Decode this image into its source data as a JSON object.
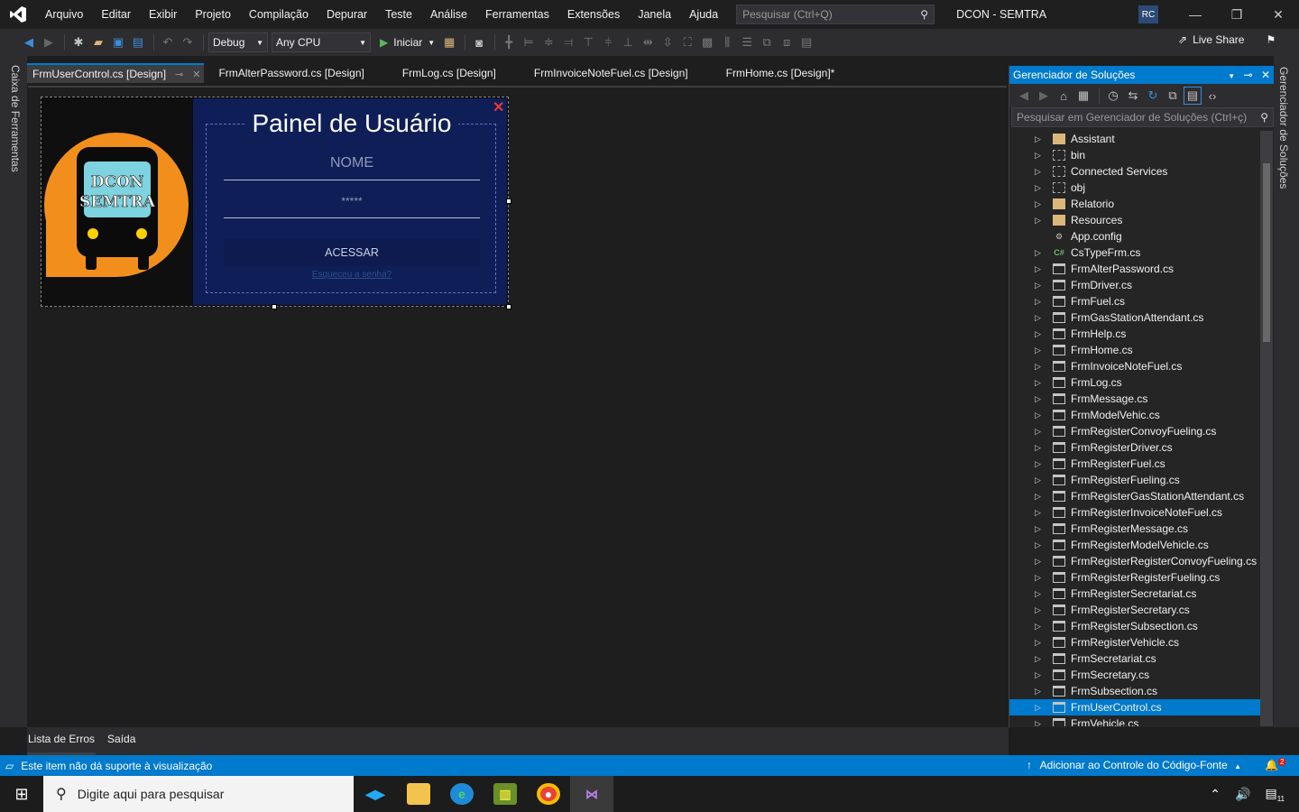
{
  "menu": {
    "items": [
      "Arquivo",
      "Editar",
      "Exibir",
      "Projeto",
      "Compilação",
      "Depurar",
      "Teste",
      "Análise",
      "Ferramentas",
      "Extensões",
      "Janela",
      "Ajuda"
    ],
    "search_placeholder": "Pesquisar (Ctrl+Q)",
    "window_title": "DCON - SEMTRA",
    "user_initials": "RC"
  },
  "toolbar": {
    "config": "Debug",
    "platform": "Any CPU",
    "start_label": "Iniciar",
    "liveshare_label": "Live Share"
  },
  "toolbox": {
    "label": "Caixa de Ferramentas"
  },
  "doc_tabs": [
    "FrmUserControl.cs [Design]",
    "FrmAlterPassword.cs [Design]",
    "FrmLog.cs [Design]",
    "FrmInvoiceNoteFuel.cs [Design]",
    "FrmHome.cs [Design]*"
  ],
  "form": {
    "title": "Painel de Usuário",
    "logo_line1": "DCON",
    "logo_line2": "SEMTRA",
    "name_placeholder": "NOME",
    "password_value": "*****",
    "button_label": "ACESSAR",
    "forgot_link": "Esqueceu a senha?",
    "close_glyph": "✕"
  },
  "bottom_tabs": [
    "Lista de Erros",
    "Saída"
  ],
  "solution_explorer": {
    "title": "Gerenciador de Soluções",
    "search_placeholder": "Pesquisar em Gerenciador de Soluções (Ctrl+ç)",
    "side_label": "Gerenciador de Soluções",
    "items": [
      {
        "label": "Assistant",
        "icon": "folder"
      },
      {
        "label": "bin",
        "icon": "folder-dash"
      },
      {
        "label": "Connected Services",
        "icon": "folder-dash"
      },
      {
        "label": "obj",
        "icon": "folder-dash"
      },
      {
        "label": "Relatorio",
        "icon": "folder"
      },
      {
        "label": "Resources",
        "icon": "folder"
      },
      {
        "label": "App.config",
        "icon": "config"
      },
      {
        "label": "CsTypeFrm.cs",
        "icon": "cs"
      },
      {
        "label": "FrmAlterPassword.cs",
        "icon": "form"
      },
      {
        "label": "FrmDriver.cs",
        "icon": "form"
      },
      {
        "label": "FrmFuel.cs",
        "icon": "form"
      },
      {
        "label": "FrmGasStationAttendant.cs",
        "icon": "form"
      },
      {
        "label": "FrmHelp.cs",
        "icon": "form"
      },
      {
        "label": "FrmHome.cs",
        "icon": "form"
      },
      {
        "label": "FrmInvoiceNoteFuel.cs",
        "icon": "form"
      },
      {
        "label": "FrmLog.cs",
        "icon": "form"
      },
      {
        "label": "FrmMessage.cs",
        "icon": "form"
      },
      {
        "label": "FrmModelVehic.cs",
        "icon": "form"
      },
      {
        "label": "FrmRegisterConvoyFueling.cs",
        "icon": "form"
      },
      {
        "label": "FrmRegisterDriver.cs",
        "icon": "form"
      },
      {
        "label": "FrmRegisterFuel.cs",
        "icon": "form"
      },
      {
        "label": "FrmRegisterFueling.cs",
        "icon": "form"
      },
      {
        "label": "FrmRegisterGasStationAttendant.cs",
        "icon": "form"
      },
      {
        "label": "FrmRegisterInvoiceNoteFuel.cs",
        "icon": "form"
      },
      {
        "label": "FrmRegisterMessage.cs",
        "icon": "form"
      },
      {
        "label": "FrmRegisterModelVehicle.cs",
        "icon": "form"
      },
      {
        "label": "FrmRegisterRegisterConvoyFueling.cs",
        "icon": "form"
      },
      {
        "label": "FrmRegisterRegisterFueling.cs",
        "icon": "form"
      },
      {
        "label": "FrmRegisterSecretariat.cs",
        "icon": "form"
      },
      {
        "label": "FrmRegisterSecretary.cs",
        "icon": "form"
      },
      {
        "label": "FrmRegisterSubsection.cs",
        "icon": "form"
      },
      {
        "label": "FrmRegisterVehicle.cs",
        "icon": "form"
      },
      {
        "label": "FrmSecretariat.cs",
        "icon": "form"
      },
      {
        "label": "FrmSecretary.cs",
        "icon": "form"
      },
      {
        "label": "FrmSubsection.cs",
        "icon": "form"
      },
      {
        "label": "FrmUserControl.cs",
        "icon": "form",
        "selected": true
      },
      {
        "label": "FrmVehicle.cs",
        "icon": "form"
      }
    ]
  },
  "statusbar": {
    "text": "Este item não dá suporte à visualização",
    "source_control": "Adicionar ao Controle do Código-Fonte",
    "notifications": "2"
  },
  "taskbar": {
    "search_placeholder": "Digite aqui para pesquisar",
    "notification_count": "11"
  },
  "colors": {
    "accent": "#007acc",
    "panel_blue": "#0f1e56",
    "logo_orange": "#f28f1c"
  }
}
